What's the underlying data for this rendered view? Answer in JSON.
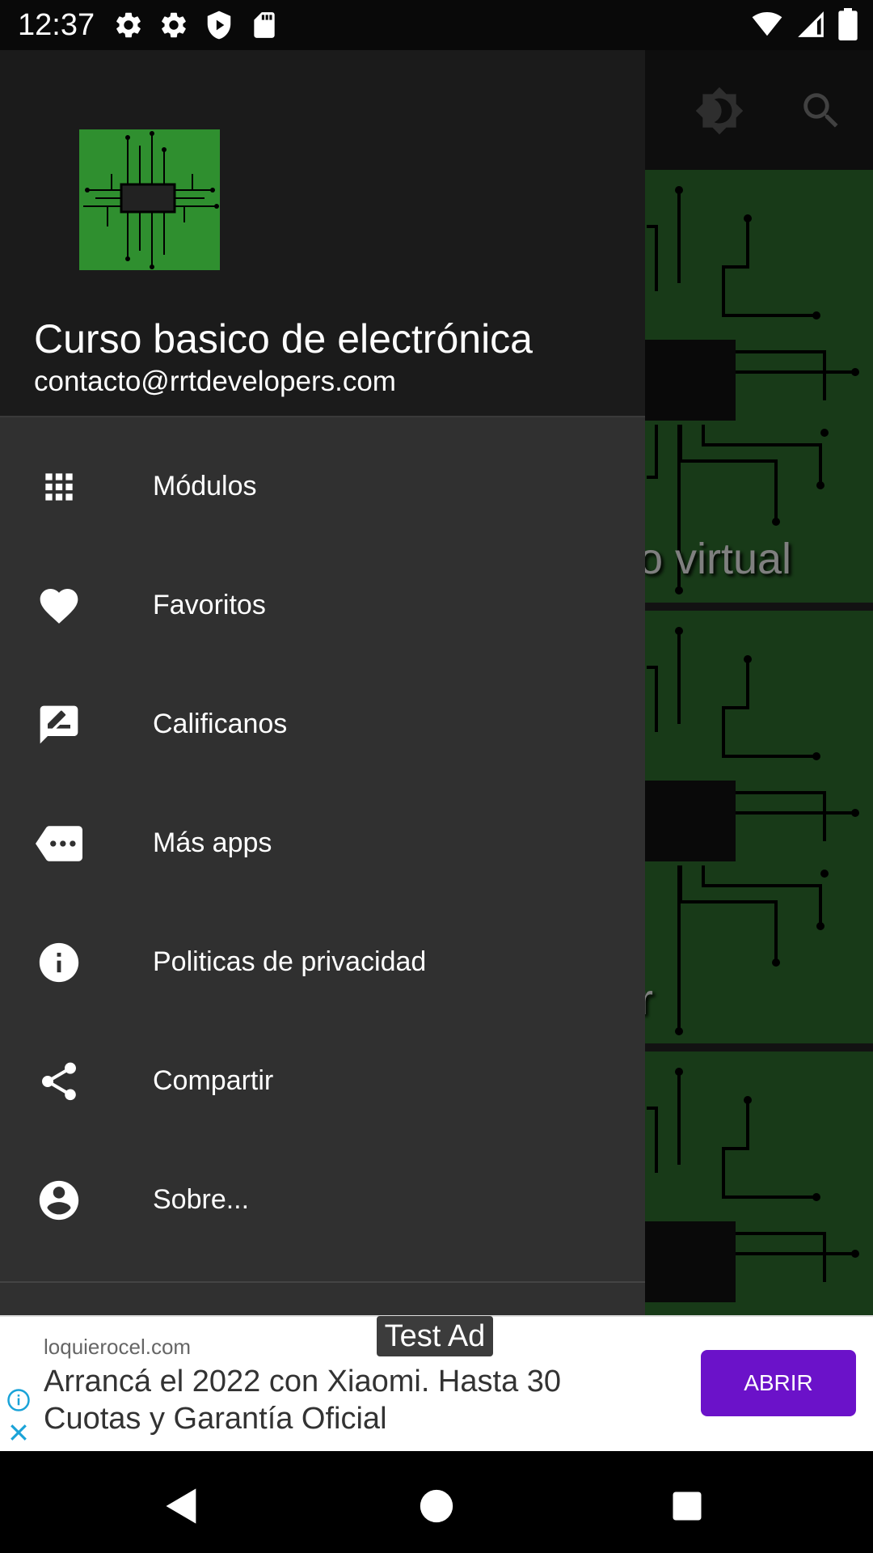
{
  "status_bar": {
    "time": "12:37",
    "left_icons": [
      "gear-icon",
      "gear-icon",
      "shield-icon",
      "sd-card-icon"
    ],
    "right_icons": [
      "wifi-icon",
      "cell-signal-icon",
      "battery-icon"
    ]
  },
  "background_app": {
    "toolbar_icons": [
      "brightness-icon",
      "search-icon"
    ],
    "cards": [
      {
        "title": "rio virtual"
      },
      {
        "title": "r"
      },
      {
        "title": ""
      }
    ],
    "card_color": "#2c6b2c"
  },
  "drawer": {
    "app_name": "Curso basico de electrónica",
    "email": "contacto@rrtdevelopers.com",
    "items": [
      {
        "label": "Módulos",
        "icon": "grid-icon"
      },
      {
        "label": "Favoritos",
        "icon": "heart-icon"
      },
      {
        "label": "Calificanos",
        "icon": "rate-review-icon"
      },
      {
        "label": "Más apps",
        "icon": "more-apps-icon"
      },
      {
        "label": "Politicas de privacidad",
        "icon": "info-icon"
      },
      {
        "label": "Compartir",
        "icon": "share-icon"
      },
      {
        "label": "Sobre...",
        "icon": "account-circle-icon"
      }
    ]
  },
  "ad": {
    "badge": "Test Ad",
    "domain": "loquierocel.com",
    "text": "Arrancá el 2022 con Xiaomi. Hasta 30 Cuotas y Garantía Oficial",
    "button": "ABRIR",
    "button_color": "#6b12c9"
  },
  "nav_bar": {
    "buttons": [
      "back-icon",
      "home-icon",
      "recents-icon"
    ]
  }
}
